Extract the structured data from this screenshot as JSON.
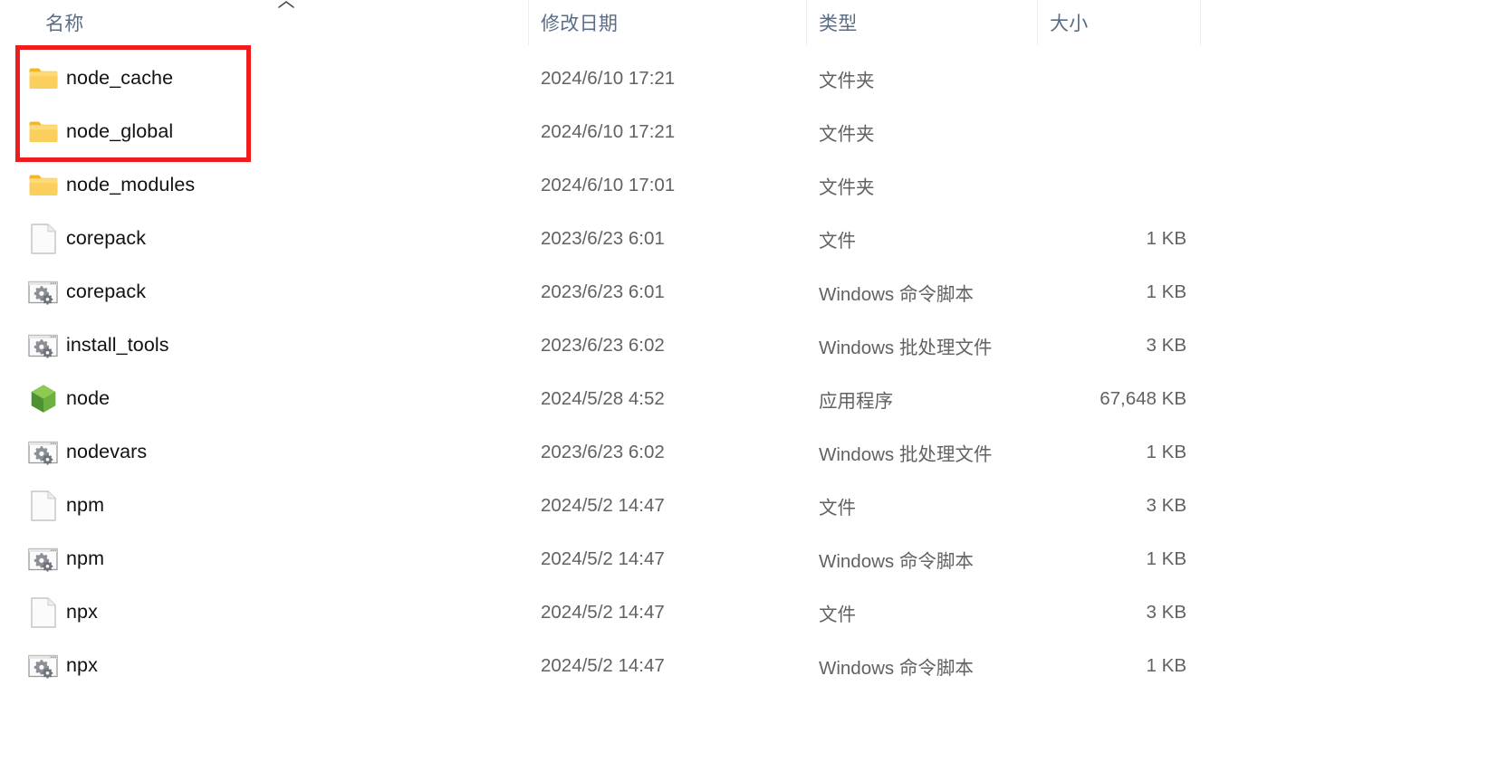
{
  "window": {
    "title": "node_files_explorer_view"
  },
  "columns": {
    "name": "名称",
    "date_modified": "修改日期",
    "type": "类型",
    "size": "大小",
    "sort_icon": "chevron-up-icon",
    "sort_column": "名称",
    "sort_direction": "ascending"
  },
  "annotation": {
    "color": "#ee1c1c",
    "shape": "rectangle",
    "targets": [
      "node_cache",
      "node_global"
    ]
  },
  "rows": [
    {
      "name": "node_cache",
      "icon": "folder-icon",
      "date": "2024/6/10 17:21",
      "type": "文件夹",
      "size": ""
    },
    {
      "name": "node_global",
      "icon": "folder-icon",
      "date": "2024/6/10 17:21",
      "type": "文件夹",
      "size": ""
    },
    {
      "name": "node_modules",
      "icon": "folder-icon",
      "date": "2024/6/10 17:01",
      "type": "文件夹",
      "size": ""
    },
    {
      "name": "corepack",
      "icon": "blank-file-icon",
      "date": "2023/6/23 6:01",
      "type": "文件",
      "size": "1 KB"
    },
    {
      "name": "corepack",
      "icon": "script-file-icon",
      "date": "2023/6/23 6:01",
      "type": "Windows 命令脚本",
      "size": "1 KB"
    },
    {
      "name": "install_tools",
      "icon": "script-file-icon",
      "date": "2023/6/23 6:02",
      "type": "Windows 批处理文件",
      "size": "3 KB"
    },
    {
      "name": "node",
      "icon": "nodejs-app-icon",
      "date": "2024/5/28 4:52",
      "type": "应用程序",
      "size": "67,648 KB"
    },
    {
      "name": "nodevars",
      "icon": "script-file-icon",
      "date": "2023/6/23 6:02",
      "type": "Windows 批处理文件",
      "size": "1 KB"
    },
    {
      "name": "npm",
      "icon": "blank-file-icon",
      "date": "2024/5/2 14:47",
      "type": "文件",
      "size": "3 KB"
    },
    {
      "name": "npm",
      "icon": "script-file-icon",
      "date": "2024/5/2 14:47",
      "type": "Windows 命令脚本",
      "size": "1 KB"
    },
    {
      "name": "npx",
      "icon": "blank-file-icon",
      "date": "2024/5/2 14:47",
      "type": "文件",
      "size": "3 KB"
    },
    {
      "name": "npx",
      "icon": "script-file-icon",
      "date": "2024/5/2 14:47",
      "type": "Windows 命令脚本",
      "size": "1 KB"
    }
  ],
  "colors": {
    "header_text": "#5b6c85",
    "row_text": "#111111",
    "meta_text": "#626262",
    "folder_icon": "#f7c64a",
    "node_green": "#5aa53f",
    "annotation_red": "#ee1c1c",
    "background": "#ffffff"
  }
}
